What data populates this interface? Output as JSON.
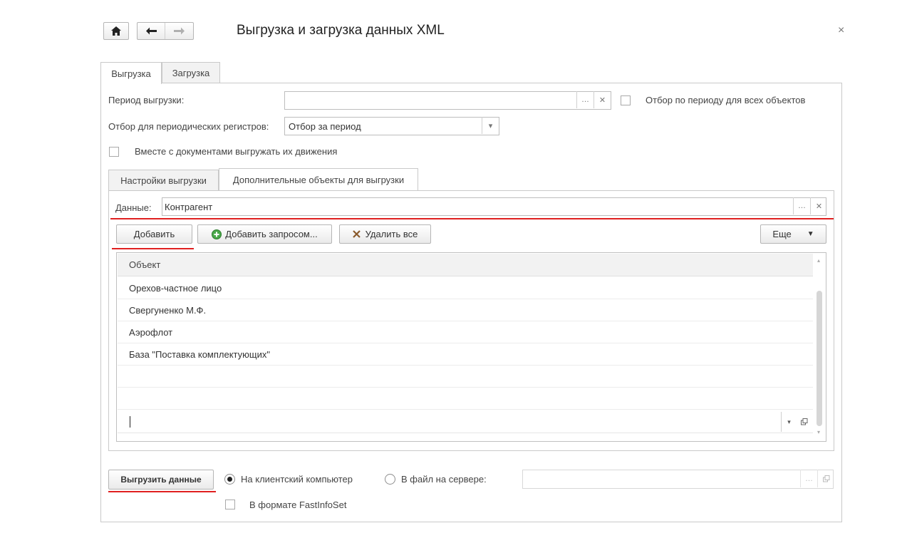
{
  "window": {
    "title": "Выгрузка и загрузка данных XML",
    "close_glyph": "×"
  },
  "nav": {
    "home_icon": "home-icon",
    "back_icon": "arrow-left-icon",
    "forward_icon": "arrow-right-icon"
  },
  "tabs": [
    {
      "label": "Выгрузка",
      "active": true
    },
    {
      "label": "Загрузка",
      "active": false
    }
  ],
  "export": {
    "period_label": "Период выгрузки:",
    "period_value": "",
    "period_filter_all_label": "Отбор по периоду для всех объектов",
    "periodic_filter_label": "Отбор для периодических регистров:",
    "periodic_filter_value": "Отбор за период",
    "with_movements_label": "Вместе с документами выгружать их движения"
  },
  "subtabs": [
    {
      "label": "Настройки выгрузки",
      "active": false
    },
    {
      "label": "Дополнительные объекты для выгрузки",
      "active": true
    }
  ],
  "additional": {
    "data_label": "Данные:",
    "data_value": "Контрагент",
    "add_button": "Добавить",
    "add_by_query_button": "Добавить запросом...",
    "delete_all_button": "Удалить все",
    "more_button": "Еще",
    "column_header": "Объект",
    "rows": [
      "Орехов-частное лицо",
      "Свергуненко М.Ф.",
      "Аэрофлот",
      "База \"Поставка комплектующих\""
    ]
  },
  "footer": {
    "export_button": "Выгрузить данные",
    "radio_client": "На клиентский компьютер",
    "radio_server": "В файл на сервере:",
    "server_path": "",
    "fastinfoset_label": "В формате FastInfoSet",
    "selected_target": "client"
  },
  "colors": {
    "highlight": "#e02020",
    "border": "#c9c9c9",
    "add_icon_green": "#3a9b3a",
    "delete_icon": "#8a5a2b"
  }
}
